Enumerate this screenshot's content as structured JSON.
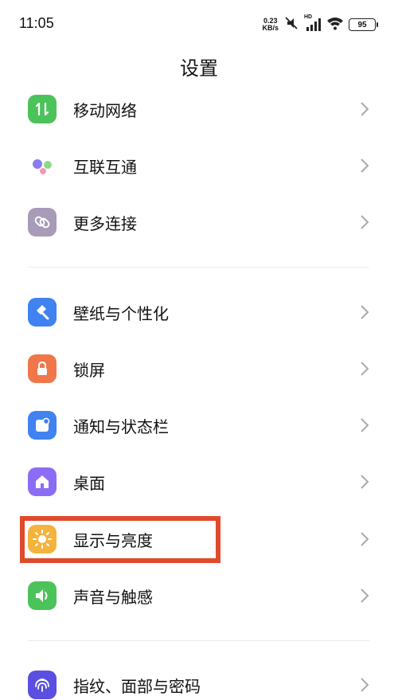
{
  "status_bar": {
    "time": "11:05",
    "net_speed_value": "0.23",
    "net_speed_unit": "KB/s",
    "hd_label": "HD",
    "battery": "95"
  },
  "page_title": "设置",
  "sections": [
    {
      "items": [
        {
          "label": "移动网络",
          "icon": "mobile-network-icon",
          "color": "#4cc35a"
        },
        {
          "label": "互联互通",
          "icon": "interconnect-icon",
          "color": "#ffffff"
        },
        {
          "label": "更多连接",
          "icon": "link-icon",
          "color": "#a79bb8"
        }
      ]
    },
    {
      "items": [
        {
          "label": "壁纸与个性化",
          "icon": "wallpaper-brush-icon",
          "color": "#3f82f0"
        },
        {
          "label": "锁屏",
          "icon": "lock-icon",
          "color": "#f0774a"
        },
        {
          "label": "通知与状态栏",
          "icon": "notification-icon",
          "color": "#3f82f0"
        },
        {
          "label": "桌面",
          "icon": "home-icon",
          "color": "#8b6cf5"
        },
        {
          "label": "显示与亮度",
          "icon": "brightness-icon",
          "color": "#f4b33c"
        },
        {
          "label": "声音与触感",
          "icon": "sound-icon",
          "color": "#4cc35a"
        }
      ]
    },
    {
      "items": [
        {
          "label": "指纹、面部与密码",
          "icon": "fingerprint-icon",
          "color": "#5a4fe0"
        }
      ]
    }
  ],
  "highlight_color": "#e04a2c"
}
